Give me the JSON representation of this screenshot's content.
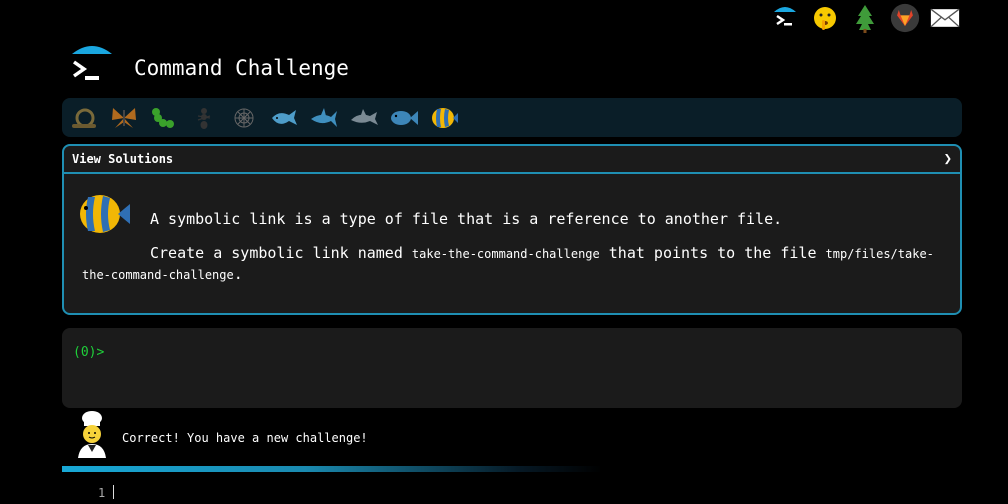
{
  "header": {
    "title": "Command Challenge"
  },
  "top_nav": {
    "icons": [
      "terminal-icon",
      "shush-face-icon",
      "tree-icon",
      "gitlab-icon",
      "mail-icon"
    ]
  },
  "levels": [
    "snail-icon",
    "butterfly-icon",
    "caterpillar-icon",
    "ant-icon",
    "spider-web-icon",
    "whale-icon",
    "shark-icon",
    "dolphin-icon",
    "fish-icon",
    "tropical-fish-icon"
  ],
  "challenge": {
    "solutions_label": "View Solutions",
    "chevron": "❯",
    "line1": "A symbolic link is a type of file that is a reference to another file.",
    "line2_pre": "Create a symbolic link named ",
    "link_name": "take-the-command-challenge",
    "line2_mid": " that points to the file ",
    "target_path": "tmp/files/take-the-command-challenge",
    "line2_post": "."
  },
  "terminal": {
    "prompt": "(0)>"
  },
  "result": {
    "message": "Correct! You have a new challenge!"
  },
  "editor": {
    "line_number": "1"
  },
  "colors": {
    "accent": "#1f8fb3",
    "prompt": "#1fd13a",
    "panel_bg": "#1b1b1b",
    "level_bar_bg": "#0a1e28"
  }
}
